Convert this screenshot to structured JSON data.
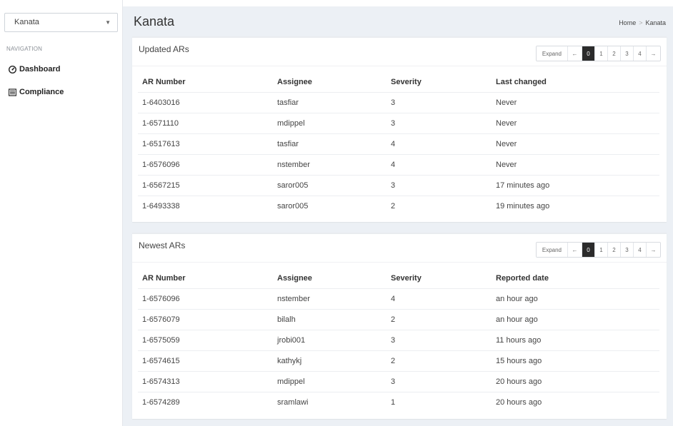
{
  "sidebar": {
    "site_select": "Kanata",
    "nav_header": "NAVIGATION",
    "items": [
      {
        "label": "Dashboard",
        "icon": "dashboard-icon"
      },
      {
        "label": "Compliance",
        "icon": "compliance-icon"
      }
    ]
  },
  "page": {
    "title": "Kanata",
    "breadcrumb": {
      "home": "Home",
      "current": "Kanata",
      "separator": ">"
    }
  },
  "pager": {
    "expand": "Expand",
    "prev": "←",
    "next": "→",
    "pages": [
      "0",
      "1",
      "2",
      "3",
      "4"
    ],
    "active_page": "0"
  },
  "updated_ars": {
    "title": "Updated ARs",
    "columns": [
      "AR Number",
      "Assignee",
      "Severity",
      "Last changed"
    ],
    "rows": [
      [
        "1-6403016",
        "tasfiar",
        "3",
        "Never"
      ],
      [
        "1-6571110",
        "mdippel",
        "3",
        "Never"
      ],
      [
        "1-6517613",
        "tasfiar",
        "4",
        "Never"
      ],
      [
        "1-6576096",
        "nstember",
        "4",
        "Never"
      ],
      [
        "1-6567215",
        "saror005",
        "3",
        "17 minutes ago"
      ],
      [
        "1-6493338",
        "saror005",
        "2",
        "19 minutes ago"
      ]
    ]
  },
  "newest_ars": {
    "title": "Newest ARs",
    "columns": [
      "AR Number",
      "Assignee",
      "Severity",
      "Reported date"
    ],
    "rows": [
      [
        "1-6576096",
        "nstember",
        "4",
        "an hour ago"
      ],
      [
        "1-6576079",
        "bilalh",
        "2",
        "an hour ago"
      ],
      [
        "1-6575059",
        "jrobi001",
        "3",
        "11 hours ago"
      ],
      [
        "1-6574615",
        "kathykj",
        "2",
        "15 hours ago"
      ],
      [
        "1-6574313",
        "mdippel",
        "3",
        "20 hours ago"
      ],
      [
        "1-6574289",
        "sramlawi",
        "1",
        "20 hours ago"
      ]
    ]
  }
}
